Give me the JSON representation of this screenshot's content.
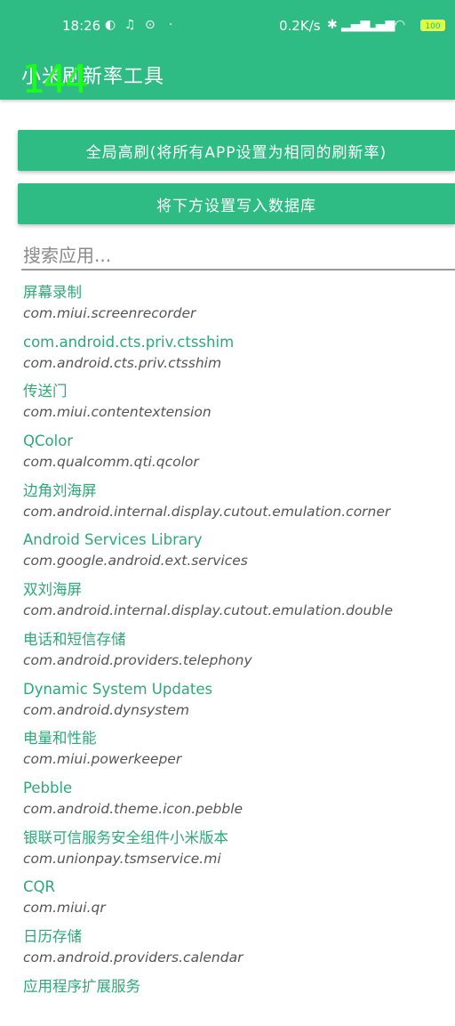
{
  "status_bar": {
    "time": "18:26",
    "net_speed": "0.2K/s",
    "battery": "100"
  },
  "fps_overlay": "144",
  "app_bar": {
    "title": "小米刷新率工具"
  },
  "buttons": {
    "global_high": "全局高刷(将所有APP设置为相同的刷新率)",
    "write_db": "将下方设置写入数据库"
  },
  "search": {
    "placeholder": "搜索应用..."
  },
  "apps": [
    {
      "name": "屏幕录制",
      "package": "com.miui.screenrecorder"
    },
    {
      "name": "com.android.cts.priv.ctsshim",
      "package": "com.android.cts.priv.ctsshim"
    },
    {
      "name": "传送门",
      "package": "com.miui.contentextension"
    },
    {
      "name": "QColor",
      "package": "com.qualcomm.qti.qcolor"
    },
    {
      "name": "边角刘海屏",
      "package": "com.android.internal.display.cutout.emulation.corner"
    },
    {
      "name": "Android Services Library",
      "package": "com.google.android.ext.services"
    },
    {
      "name": "双刘海屏",
      "package": "com.android.internal.display.cutout.emulation.double"
    },
    {
      "name": "电话和短信存储",
      "package": "com.android.providers.telephony"
    },
    {
      "name": "Dynamic System Updates",
      "package": "com.android.dynsystem"
    },
    {
      "name": "电量和性能",
      "package": "com.miui.powerkeeper"
    },
    {
      "name": "Pebble",
      "package": "com.android.theme.icon.pebble"
    },
    {
      "name": "银联可信服务安全组件小米版本",
      "package": "com.unionpay.tsmservice.mi"
    },
    {
      "name": "CQR",
      "package": "com.miui.qr"
    },
    {
      "name": "日历存储",
      "package": "com.android.providers.calendar"
    },
    {
      "name": "应用程序扩展服务",
      "package": ""
    }
  ],
  "colors": {
    "accent": "#2fbb84",
    "app_name": "#2fa879"
  }
}
